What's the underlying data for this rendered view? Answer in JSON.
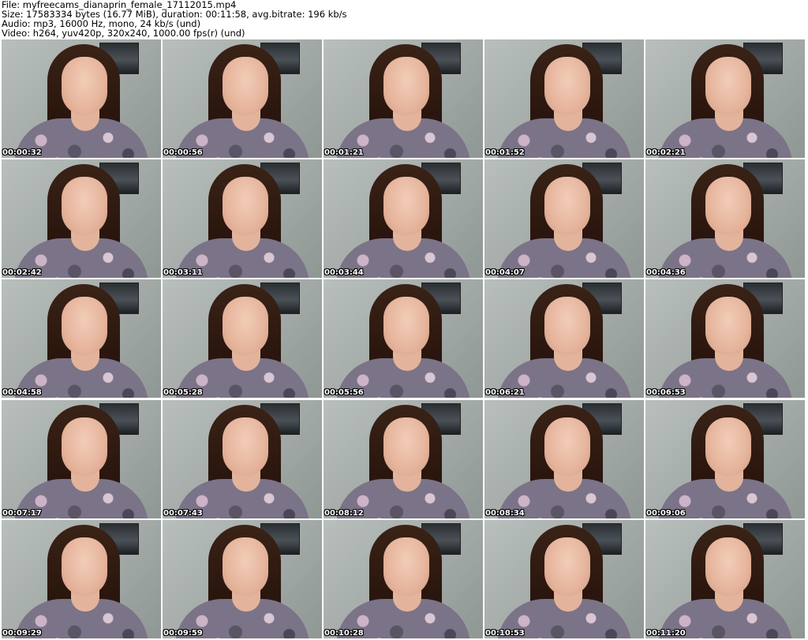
{
  "header": {
    "file_line": "File: myfreecams_dianaprin_female_17112015.mp4",
    "size_line": "Size: 17583334 bytes (16.77 MiB), duration: 00:11:58, avg.bitrate: 196 kb/s",
    "audio_line": "Audio: mp3, 16000 Hz, mono, 24 kb/s (und)",
    "video_line": "Video: h264, yuv420p, 320x240, 1000.00 fps(r) (und)"
  },
  "thumbnails": [
    {
      "timestamp": "00:00:32"
    },
    {
      "timestamp": "00:00:56"
    },
    {
      "timestamp": "00:01:21"
    },
    {
      "timestamp": "00:01:52"
    },
    {
      "timestamp": "00:02:21"
    },
    {
      "timestamp": "00:02:42"
    },
    {
      "timestamp": "00:03:11"
    },
    {
      "timestamp": "00:03:44"
    },
    {
      "timestamp": "00:04:07"
    },
    {
      "timestamp": "00:04:36"
    },
    {
      "timestamp": "00:04:58"
    },
    {
      "timestamp": "00:05:28"
    },
    {
      "timestamp": "00:05:56"
    },
    {
      "timestamp": "00:06:21"
    },
    {
      "timestamp": "00:06:53"
    },
    {
      "timestamp": "00:07:17"
    },
    {
      "timestamp": "00:07:43"
    },
    {
      "timestamp": "00:08:12"
    },
    {
      "timestamp": "00:08:34"
    },
    {
      "timestamp": "00:09:06"
    },
    {
      "timestamp": "00:09:29"
    },
    {
      "timestamp": "00:09:59"
    },
    {
      "timestamp": "00:10:28"
    },
    {
      "timestamp": "00:10:53"
    },
    {
      "timestamp": "00:11:20"
    }
  ]
}
